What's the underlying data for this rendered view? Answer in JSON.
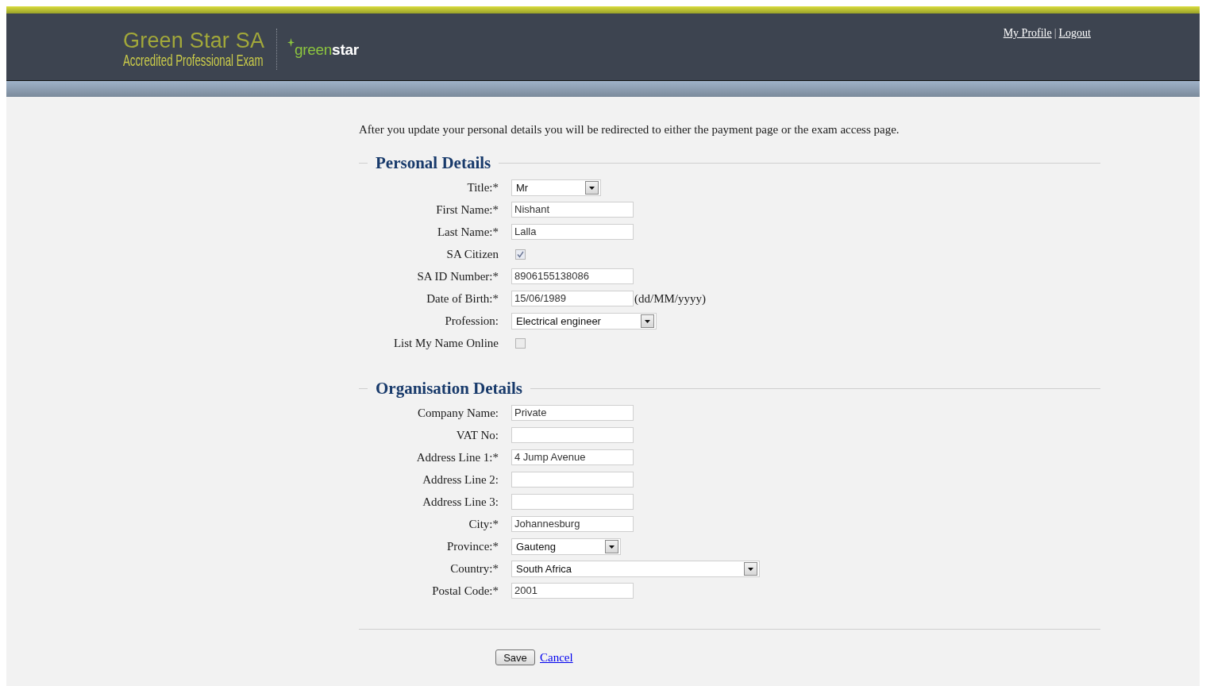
{
  "header": {
    "logo_title": "Green Star SA",
    "logo_subtitle": "Accredited Professional Exam",
    "brand": "green**star**",
    "links": [
      {
        "label": "My Profile"
      },
      {
        "label": "Logout"
      }
    ],
    "link_separator": "|"
  },
  "intro": "After you update your personal details you will be redirected to either the payment page or the exam access page.",
  "sections": [
    {
      "legend": "Personal Details",
      "fields": [
        {
          "kind": "select",
          "label": "Title:*",
          "value": "Mr"
        },
        {
          "kind": "text",
          "label": "First Name:*",
          "value": "Nishant"
        },
        {
          "kind": "text",
          "label": "Last Name:*",
          "value": "Lalla"
        },
        {
          "kind": "checkbox",
          "label": "SA Citizen",
          "checked": true
        },
        {
          "kind": "text",
          "label": "SA ID Number:*",
          "value": "8906155138086"
        },
        {
          "kind": "text",
          "label": "Date of Birth:*",
          "value": "15/06/1989",
          "hint": "(dd/MM/yyyy)"
        },
        {
          "kind": "select",
          "label": "Profession:",
          "value": "Electrical engineer"
        },
        {
          "kind": "checkbox",
          "label": "List My Name Online",
          "checked": false
        }
      ]
    },
    {
      "legend": "Organisation Details",
      "fields": [
        {
          "kind": "text",
          "label": "Company Name:",
          "value": "Private"
        },
        {
          "kind": "text",
          "label": "VAT No:"
        },
        {
          "kind": "text",
          "label": "Address Line 1:*",
          "value": "4 Jump Avenue"
        },
        {
          "kind": "text",
          "label": "Address Line 2:"
        },
        {
          "kind": "text",
          "label": "Address Line 3:"
        },
        {
          "kind": "text",
          "label": "City:*",
          "value": "Johannesburg"
        },
        {
          "kind": "select",
          "label": "Province:*",
          "value": "Gauteng"
        },
        {
          "kind": "select",
          "label": "Country:*",
          "value": "South Africa"
        },
        {
          "kind": "text",
          "label": "Postal Code:*",
          "value": "2001"
        }
      ]
    }
  ],
  "actions": {
    "save": "Save",
    "cancel": "Cancel"
  }
}
